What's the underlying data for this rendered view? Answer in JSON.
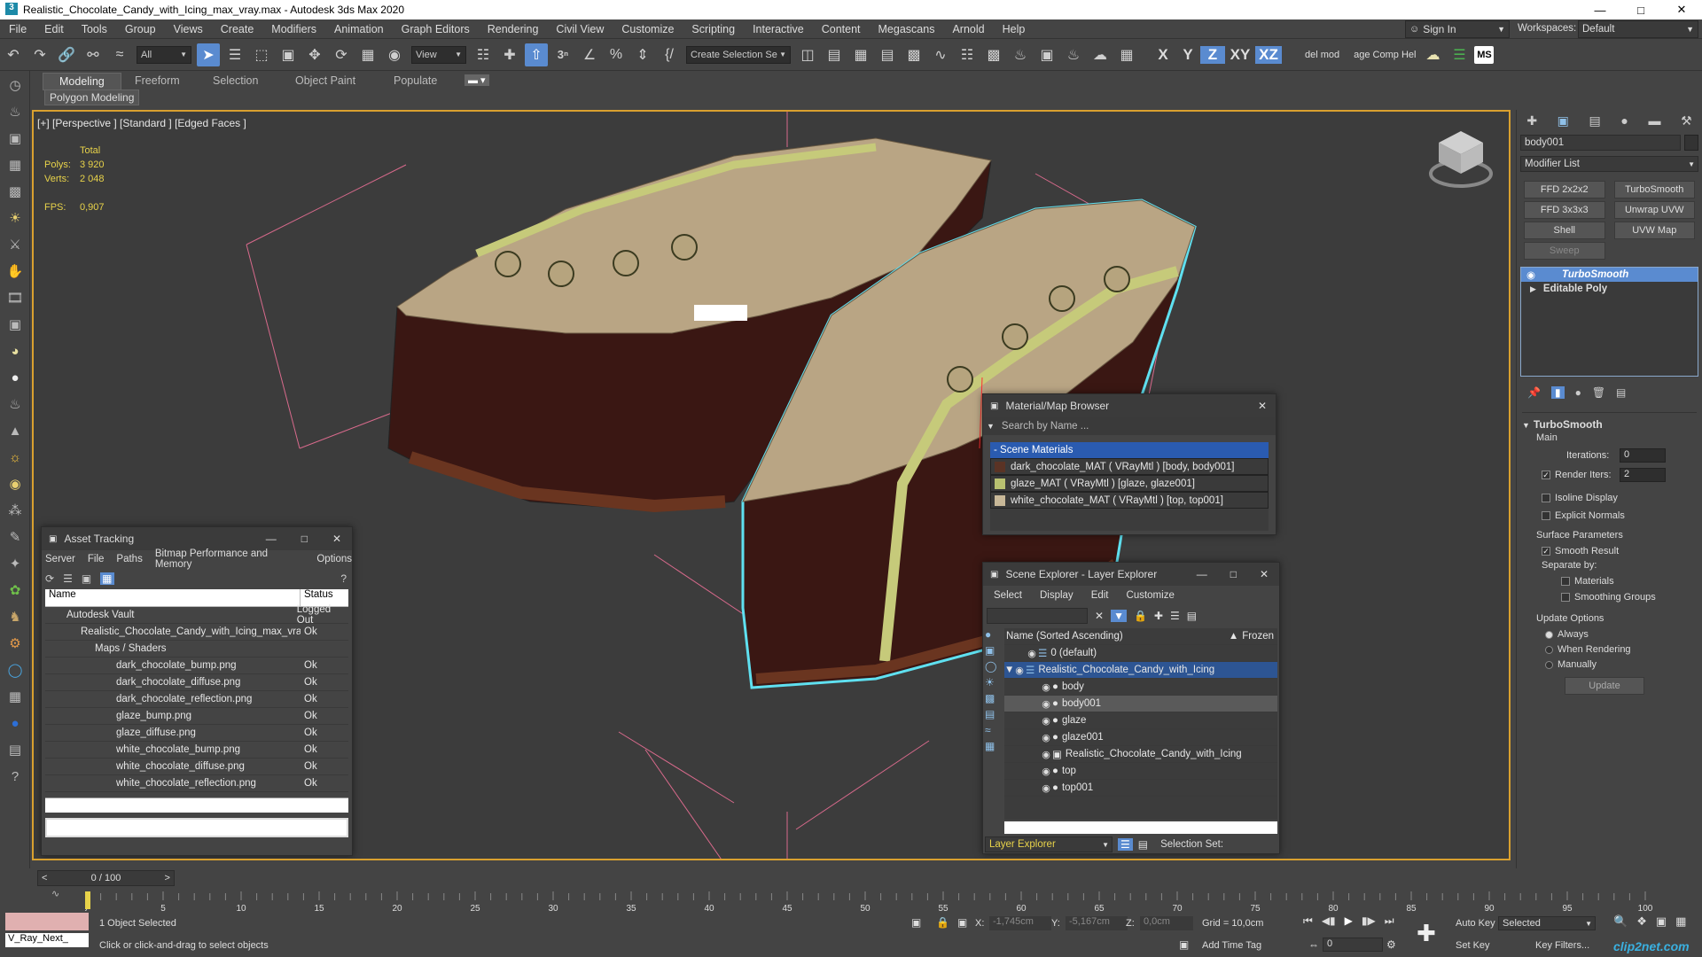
{
  "window": {
    "title": "Realistic_Chocolate_Candy_with_Icing_max_vray.max - Autodesk 3ds Max 2020"
  },
  "menu": [
    "File",
    "Edit",
    "Tools",
    "Group",
    "Views",
    "Create",
    "Modifiers",
    "Animation",
    "Graph Editors",
    "Rendering",
    "Civil View",
    "Customize",
    "Scripting",
    "Interactive",
    "Content",
    "Megascans",
    "Arnold",
    "Help"
  ],
  "account": {
    "sign_in": "Sign In",
    "workspaces_label": "Workspaces:",
    "workspace": "Default"
  },
  "toolbar": {
    "filter": "All",
    "view": "View",
    "selection_set": "Create Selection Se",
    "axes": [
      "X",
      "Y",
      "Z",
      "XY",
      "XZ"
    ],
    "del_mod": "del mod",
    "comp_help": "age Comp Hel",
    "ms": "MS"
  },
  "ribbon": {
    "tabs": [
      "Modeling",
      "Freeform",
      "Selection",
      "Object Paint",
      "Populate"
    ],
    "sub": "Polygon Modeling"
  },
  "viewport": {
    "label": "[+] [Perspective ] [Standard ] [Edged Faces ]",
    "stats": {
      "total": "Total",
      "polys_label": "Polys:",
      "polys": "3 920",
      "verts_label": "Verts:",
      "verts": "2 048",
      "fps_label": "FPS:",
      "fps": "0,907"
    }
  },
  "command_panel": {
    "object_name": "body001",
    "modifier_list": "Modifier List",
    "buttons": [
      "FFD 2x2x2",
      "TurboSmooth",
      "FFD 3x3x3",
      "Unwrap UVW",
      "Shell",
      "UVW Map",
      "Sweep"
    ],
    "stack": [
      "TurboSmooth",
      "Editable Poly"
    ],
    "rollout": "TurboSmooth",
    "main": "Main",
    "iterations_label": "Iterations:",
    "iterations": "0",
    "render_iters_label": "Render Iters:",
    "render_iters": "2",
    "isoline": "Isoline Display",
    "explicit": "Explicit Normals",
    "surface_params": "Surface Parameters",
    "smooth_result": "Smooth Result",
    "separate_by": "Separate by:",
    "materials": "Materials",
    "smoothing_groups": "Smoothing Groups",
    "update_options": "Update Options",
    "always": "Always",
    "when_rendering": "When Rendering",
    "manually": "Manually",
    "update": "Update"
  },
  "material_browser": {
    "title": "Material/Map Browser",
    "search": "Search by Name ...",
    "section": "- Scene Materials",
    "items": [
      "dark_chocolate_MAT ( VRayMtl ) [body, body001]",
      "glaze_MAT ( VRayMtl ) [glaze, glaze001]",
      "white_chocolate_MAT ( VRayMtl ) [top, top001]"
    ]
  },
  "scene_explorer": {
    "title": "Scene Explorer - Layer Explorer",
    "menu": [
      "Select",
      "Display",
      "Edit",
      "Customize"
    ],
    "col_name": "Name (Sorted Ascending)",
    "col_frozen": "Frozen",
    "rows": [
      "0 (default)",
      "Realistic_Chocolate_Candy_with_Icing",
      "body",
      "body001",
      "glaze",
      "glaze001",
      "Realistic_Chocolate_Candy_with_Icing",
      "top",
      "top001"
    ],
    "footer_left": "Layer Explorer",
    "footer_right": "Selection Set:"
  },
  "asset_tracking": {
    "title": "Asset Tracking",
    "menu": [
      "Server",
      "File",
      "Paths",
      "Bitmap Performance and Memory",
      "Options"
    ],
    "col_name": "Name",
    "col_status": "Status",
    "rows": [
      {
        "name": "Autodesk Vault",
        "status": "Logged Out"
      },
      {
        "name": "Realistic_Chocolate_Candy_with_Icing_max_vray.max",
        "status": "Ok"
      },
      {
        "name": "Maps / Shaders",
        "status": ""
      },
      {
        "name": "dark_chocolate_bump.png",
        "status": "Ok"
      },
      {
        "name": "dark_chocolate_diffuse.png",
        "status": "Ok"
      },
      {
        "name": "dark_chocolate_reflection.png",
        "status": "Ok"
      },
      {
        "name": "glaze_bump.png",
        "status": "Ok"
      },
      {
        "name": "glaze_diffuse.png",
        "status": "Ok"
      },
      {
        "name": "white_chocolate_bump.png",
        "status": "Ok"
      },
      {
        "name": "white_chocolate_diffuse.png",
        "status": "Ok"
      },
      {
        "name": "white_chocolate_reflection.png",
        "status": "Ok"
      }
    ]
  },
  "timeline": {
    "frame": "0 / 100",
    "ticks": [
      "0",
      "5",
      "10",
      "15",
      "20",
      "25",
      "30",
      "35",
      "40",
      "45",
      "50",
      "55",
      "60",
      "65",
      "70",
      "75",
      "80",
      "85",
      "90",
      "95",
      "100"
    ]
  },
  "status": {
    "script": "V_Ray_Next_",
    "selected": "1 Object Selected",
    "prompt": "Click or click-and-drag to select objects",
    "x_label": "X:",
    "x": "-1,745cm",
    "y_label": "Y:",
    "y": "-5,167cm",
    "z_label": "Z:",
    "z": "0,0cm",
    "grid": "Grid = 10,0cm",
    "add_time_tag": "Add Time Tag",
    "auto_key": "Auto Key",
    "key_mode": "Selected",
    "set_key": "Set Key",
    "key_filters": "Key Filters...",
    "frame_field": "0",
    "watermark": "clip2net.com"
  }
}
